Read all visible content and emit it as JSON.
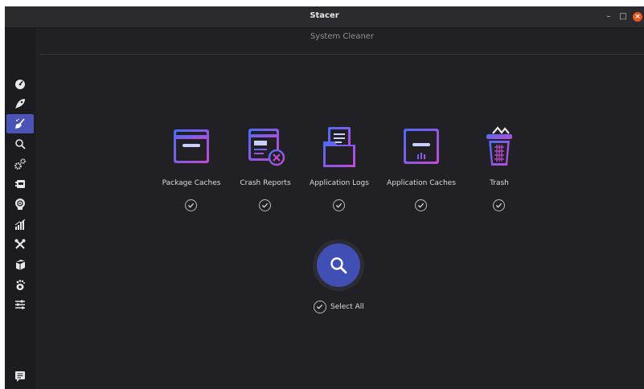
{
  "window": {
    "title": "Stacer",
    "controls": [
      "–",
      "□",
      "×"
    ]
  },
  "page": {
    "title": "System Cleaner"
  },
  "sidebar": {
    "items": [
      {
        "name": "dashboard-icon"
      },
      {
        "name": "rocket-icon"
      },
      {
        "name": "broom-icon",
        "active": true
      },
      {
        "name": "search-icon"
      },
      {
        "name": "gears-icon"
      },
      {
        "name": "uninstaller-icon"
      },
      {
        "name": "resources-icon"
      },
      {
        "name": "chart-icon"
      },
      {
        "name": "tools-icon"
      },
      {
        "name": "package-icon"
      },
      {
        "name": "gnome-icon"
      },
      {
        "name": "settings-sliders-icon"
      },
      {
        "name": "feedback-icon"
      }
    ]
  },
  "categories": [
    {
      "label": "Package Caches",
      "checked": true
    },
    {
      "label": "Crash Reports",
      "checked": true
    },
    {
      "label": "Application Logs",
      "checked": true
    },
    {
      "label": "Application Caches",
      "checked": true
    },
    {
      "label": "Trash",
      "checked": true
    }
  ],
  "actions": {
    "select_all_label": "Select All",
    "select_all_checked": true,
    "scan_icon": "search-icon"
  },
  "colors": {
    "accent": "#3f4fb3",
    "icon_gradient_start": "#4a6cf7",
    "icon_gradient_end": "#c34ad6",
    "background": "#212024"
  }
}
